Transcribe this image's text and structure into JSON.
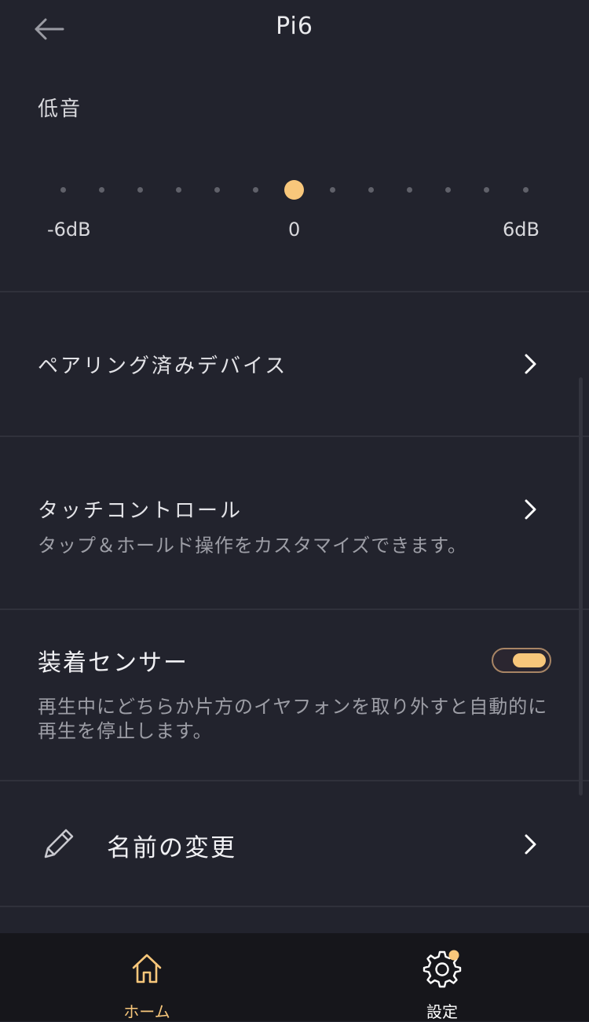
{
  "header": {
    "title": "Pi6"
  },
  "bass": {
    "title": "低音",
    "min_label": "-6dB",
    "mid_label": "0",
    "max_label": "6dB",
    "steps": 13,
    "value_db": 0
  },
  "rows": {
    "paired_devices": {
      "title": "ペアリング済みデバイス"
    },
    "touch_control": {
      "title": "タッチコントロール",
      "desc": "タップ＆ホールド操作をカスタマイズできます。"
    },
    "wear_sensor": {
      "title": "装着センサー",
      "desc": "再生中にどちらか片方のイヤフォンを取り外すと自動的に再生を停止します。",
      "enabled": true
    },
    "rename": {
      "title": "名前の変更"
    }
  },
  "tabs": {
    "home": {
      "label": "ホーム",
      "active": true
    },
    "settings": {
      "label": "設定",
      "has_badge": true
    }
  },
  "colors": {
    "accent": "#f8c77b",
    "background": "#22232d",
    "tabbar": "#16161b"
  }
}
